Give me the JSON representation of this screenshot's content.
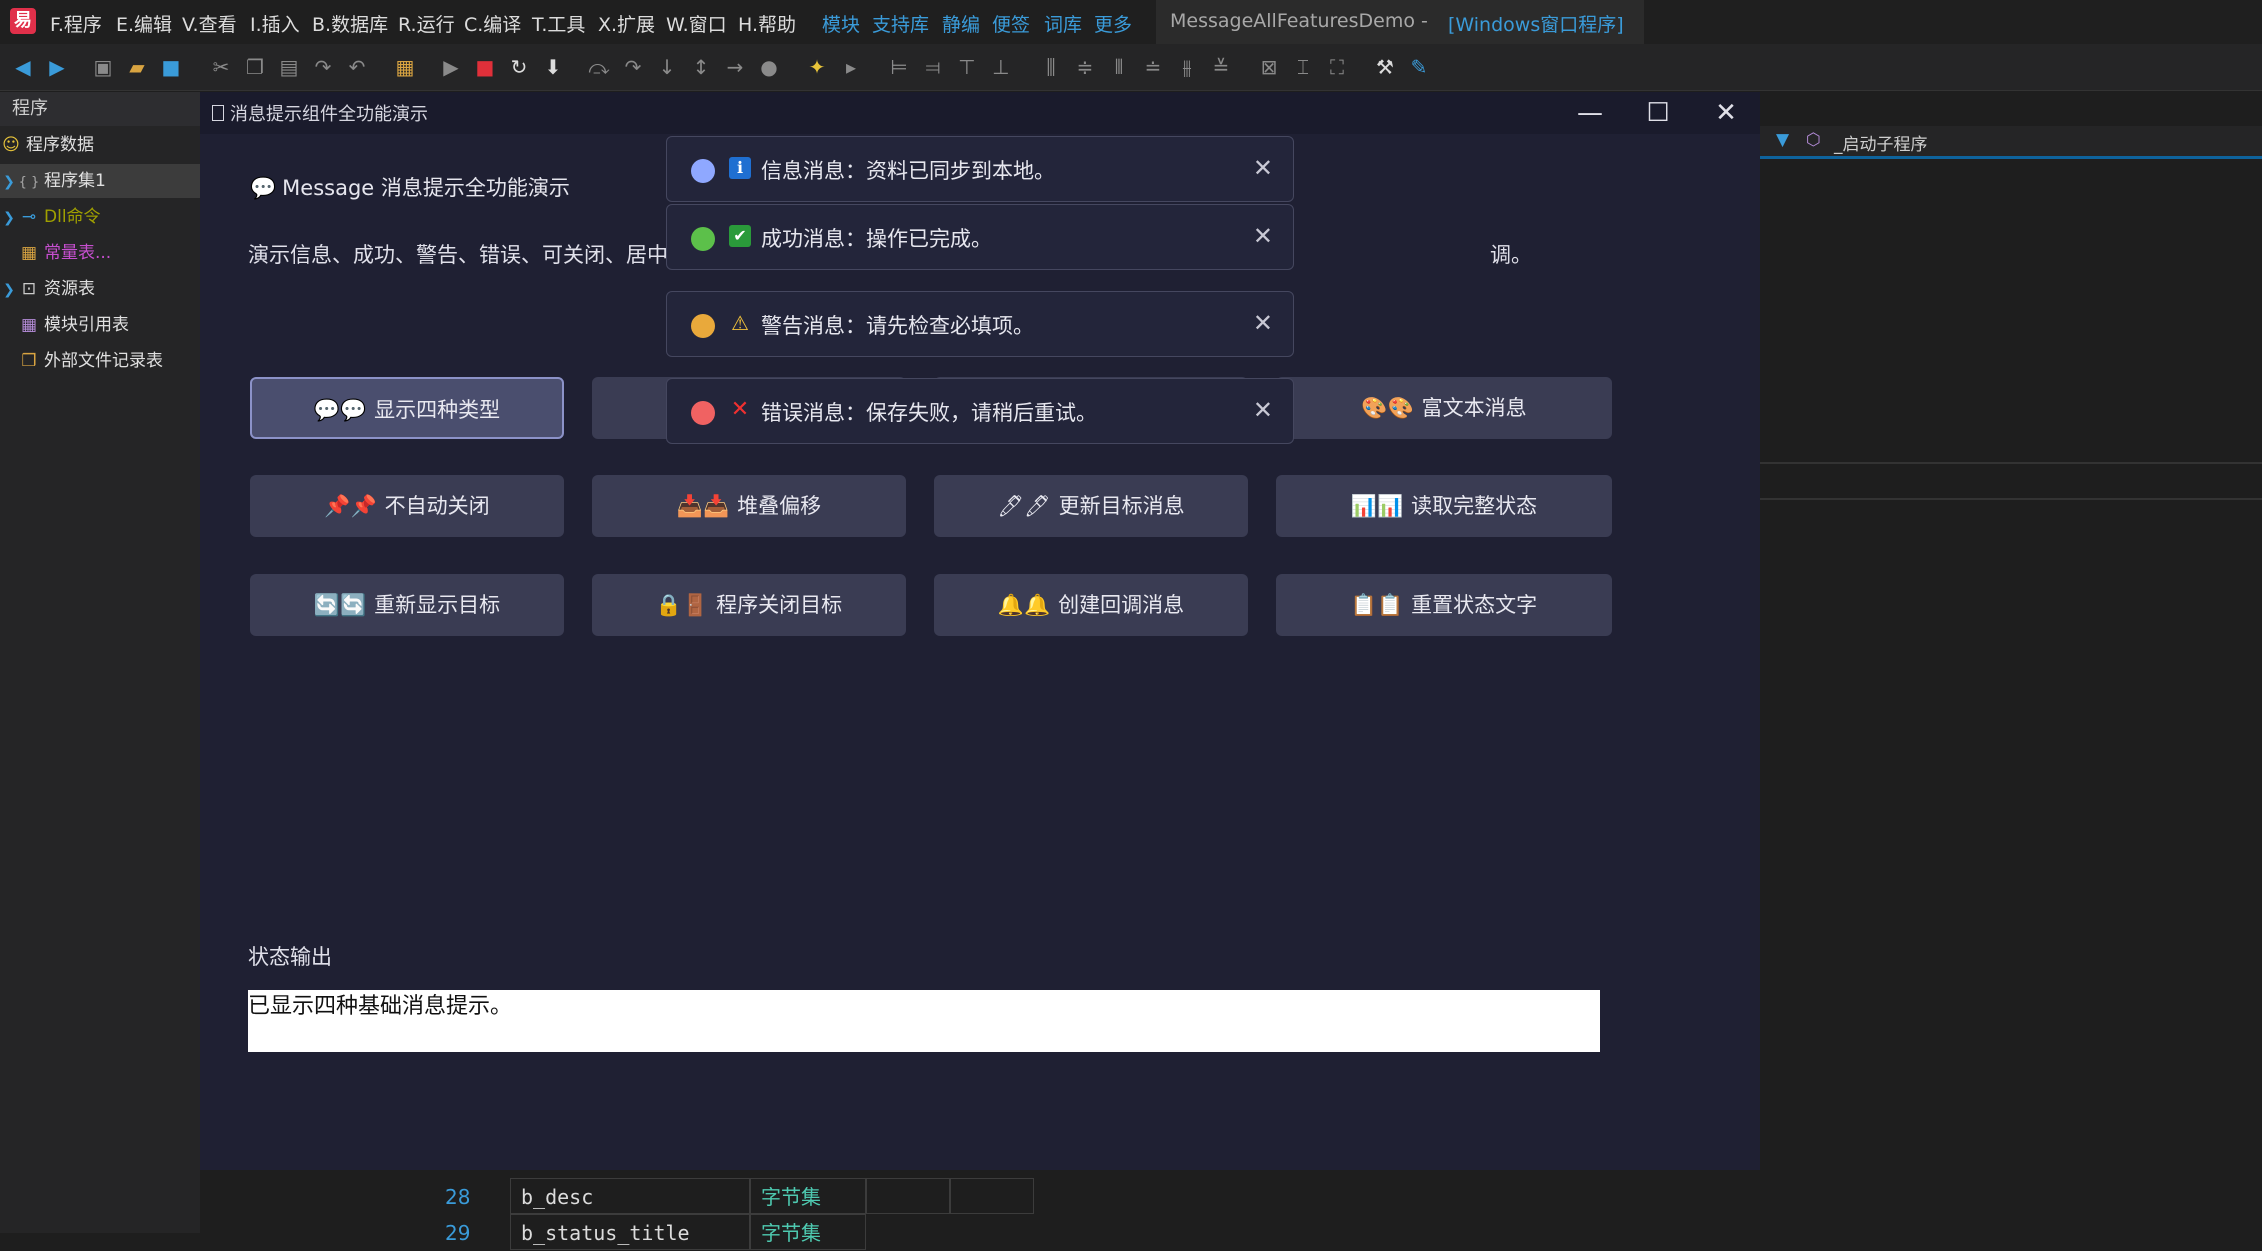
{
  "ide": {
    "menu": [
      "F.程序",
      "E.编辑",
      "V.查看",
      "I.插入",
      "B.数据库",
      "R.运行",
      "C.编译",
      "T.工具",
      "X.扩展",
      "W.窗口",
      "H.帮助"
    ],
    "links": [
      "模块",
      "支持库",
      "静编",
      "便签",
      "词库",
      "更多"
    ],
    "title_main": "MessageAllFeaturesDemo - ",
    "title_sub": "[Windows窗口程序]",
    "left_panel_title": "程序",
    "tree": [
      {
        "label": "程序数据",
        "color": "#e0e0e0",
        "icon": "smile-icon"
      },
      {
        "label": "程序集1",
        "color": "#e0e0e0",
        "icon": "braces-icon"
      },
      {
        "label": "Dll命令",
        "color": "#a0a000",
        "icon": "dll-icon"
      },
      {
        "label": "常量表...",
        "color": "#c64fcf",
        "icon": "const-icon"
      },
      {
        "label": "资源表",
        "color": "#e0e0e0",
        "icon": "resource-icon"
      },
      {
        "label": "模块引用表",
        "color": "#e0e0e0",
        "icon": "module-icon"
      },
      {
        "label": "外部文件记录表",
        "color": "#e0e0e0",
        "icon": "file-icon"
      }
    ],
    "right_panel_label": "_启动子程序",
    "grid": {
      "row1": {
        "num": "28",
        "name": "b_desc",
        "type": "字节集"
      },
      "row2": {
        "num": "29",
        "name": "b_status_title",
        "type": "字节集"
      }
    }
  },
  "app": {
    "title": "消息提示组件全功能演示",
    "heading": "Message 消息提示全功能演示",
    "description_left": "演示信息、成功、警告、错误、可关闭、居中",
    "description_right": "调。",
    "buttons": [
      {
        "label": "显示四种类型",
        "emoji": "💬💬",
        "primary": true
      },
      {
        "label": "",
        "emoji": "",
        "primary": false
      },
      {
        "label": "",
        "emoji": "",
        "primary": false
      },
      {
        "label": "富文本消息",
        "emoji": "🎨🎨",
        "primary": false
      },
      {
        "label": "不自动关闭",
        "emoji": "📌📌",
        "primary": false
      },
      {
        "label": "堆叠偏移",
        "emoji": "📥📥",
        "primary": false
      },
      {
        "label": "更新目标消息",
        "emoji": "🖊🖊",
        "primary": false
      },
      {
        "label": "读取完整状态",
        "emoji": "📊📊",
        "primary": false
      },
      {
        "label": "重新显示目标",
        "emoji": "🔄🔄",
        "primary": false
      },
      {
        "label": "程序关闭目标",
        "emoji": "🔒🚪",
        "primary": false
      },
      {
        "label": "创建回调消息",
        "emoji": "🔔🔔",
        "primary": false
      },
      {
        "label": "重置状态文字",
        "emoji": "📋📋",
        "primary": false
      }
    ],
    "status_label": "状态输出",
    "status_text": "已显示四种基础消息提示。"
  },
  "toasts": [
    {
      "type": "info",
      "dot_color": "#8fa8ff",
      "icon": "ℹ",
      "icon_bg": "#1f6fd1",
      "message": "信息消息：资料已同步到本地。"
    },
    {
      "type": "success",
      "dot_color": "#5cc04a",
      "icon": "✔",
      "icon_bg": "#2a9a3a",
      "message": "成功消息：操作已完成。"
    },
    {
      "type": "warning",
      "dot_color": "#e9a93b",
      "icon": "⚠",
      "icon_bg": "transparent",
      "message": "警告消息：请先检查必填项。"
    },
    {
      "type": "error",
      "dot_color": "#f06262",
      "icon": "✕",
      "icon_bg": "transparent",
      "message": "错误消息：保存失败，请稍后重试。"
    }
  ]
}
